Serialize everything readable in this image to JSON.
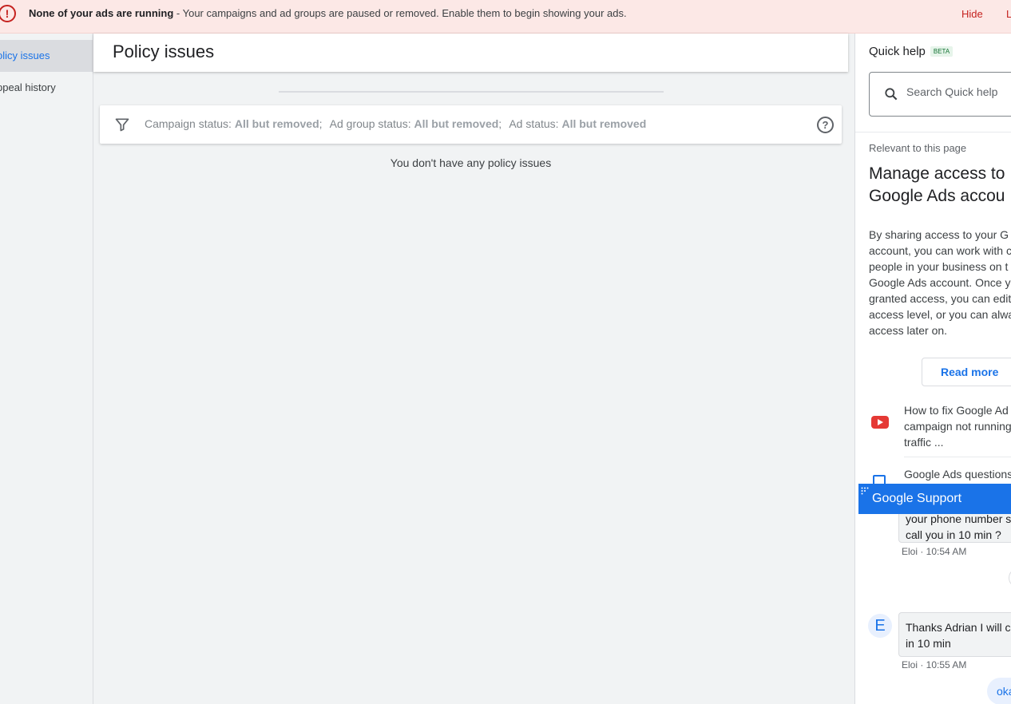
{
  "banner": {
    "title": "None of your ads are running",
    "message": " - Your campaigns and ad groups are paused or removed. Enable them to begin showing your ads.",
    "hide_label": "Hide",
    "learn_label": "L",
    "icon": "alert-circle-icon"
  },
  "nav": {
    "items": [
      {
        "label": "olicy issues",
        "active": true
      },
      {
        "label": "ppeal history",
        "active": false
      }
    ]
  },
  "main": {
    "title": "Policy issues",
    "filter": {
      "campaign_label": "Campaign status:",
      "campaign_value": "All but removed",
      "adgroup_label": "Ad group status:",
      "adgroup_value": "All but removed",
      "ad_label": "Ad status:",
      "ad_value": "All but removed",
      "separator": ";",
      "help_glyph": "?"
    },
    "empty_message": "You don't have any policy issues"
  },
  "quick_help": {
    "title": "Quick help",
    "badge": "BETA",
    "search_placeholder": "Search Quick help",
    "relevant_label": "Relevant to this page",
    "article_title_line1": "Manage access to",
    "article_title_line2": "Google Ads accou",
    "article_body": [
      "By sharing access to your G",
      "account, you can work with c",
      "people in your business on t",
      "Google Ads account. Once y",
      "granted access, you can edit",
      "access level, or you can alwa",
      "access later on."
    ],
    "read_more_label": "Read more",
    "video": {
      "lines": [
        "How to fix Google Ad",
        "campaign not running",
        "traffic ..."
      ]
    },
    "doc_link": "Google Ads questions"
  },
  "chat": {
    "title": "Google Support",
    "messages": [
      {
        "line1": "your phone number s",
        "line2": "call you in 10 min ?",
        "meta": "Eloi · 10:54 AM"
      },
      {
        "line1": "Thanks Adrian I will ca",
        "line2": "in 10 min",
        "meta": "Eloi · 10:55 AM",
        "avatar": "E"
      }
    ],
    "reply": "oka"
  },
  "colors": {
    "accent": "#1a73e8",
    "alert": "#c5221f",
    "banner_bg": "#fce8e6"
  }
}
